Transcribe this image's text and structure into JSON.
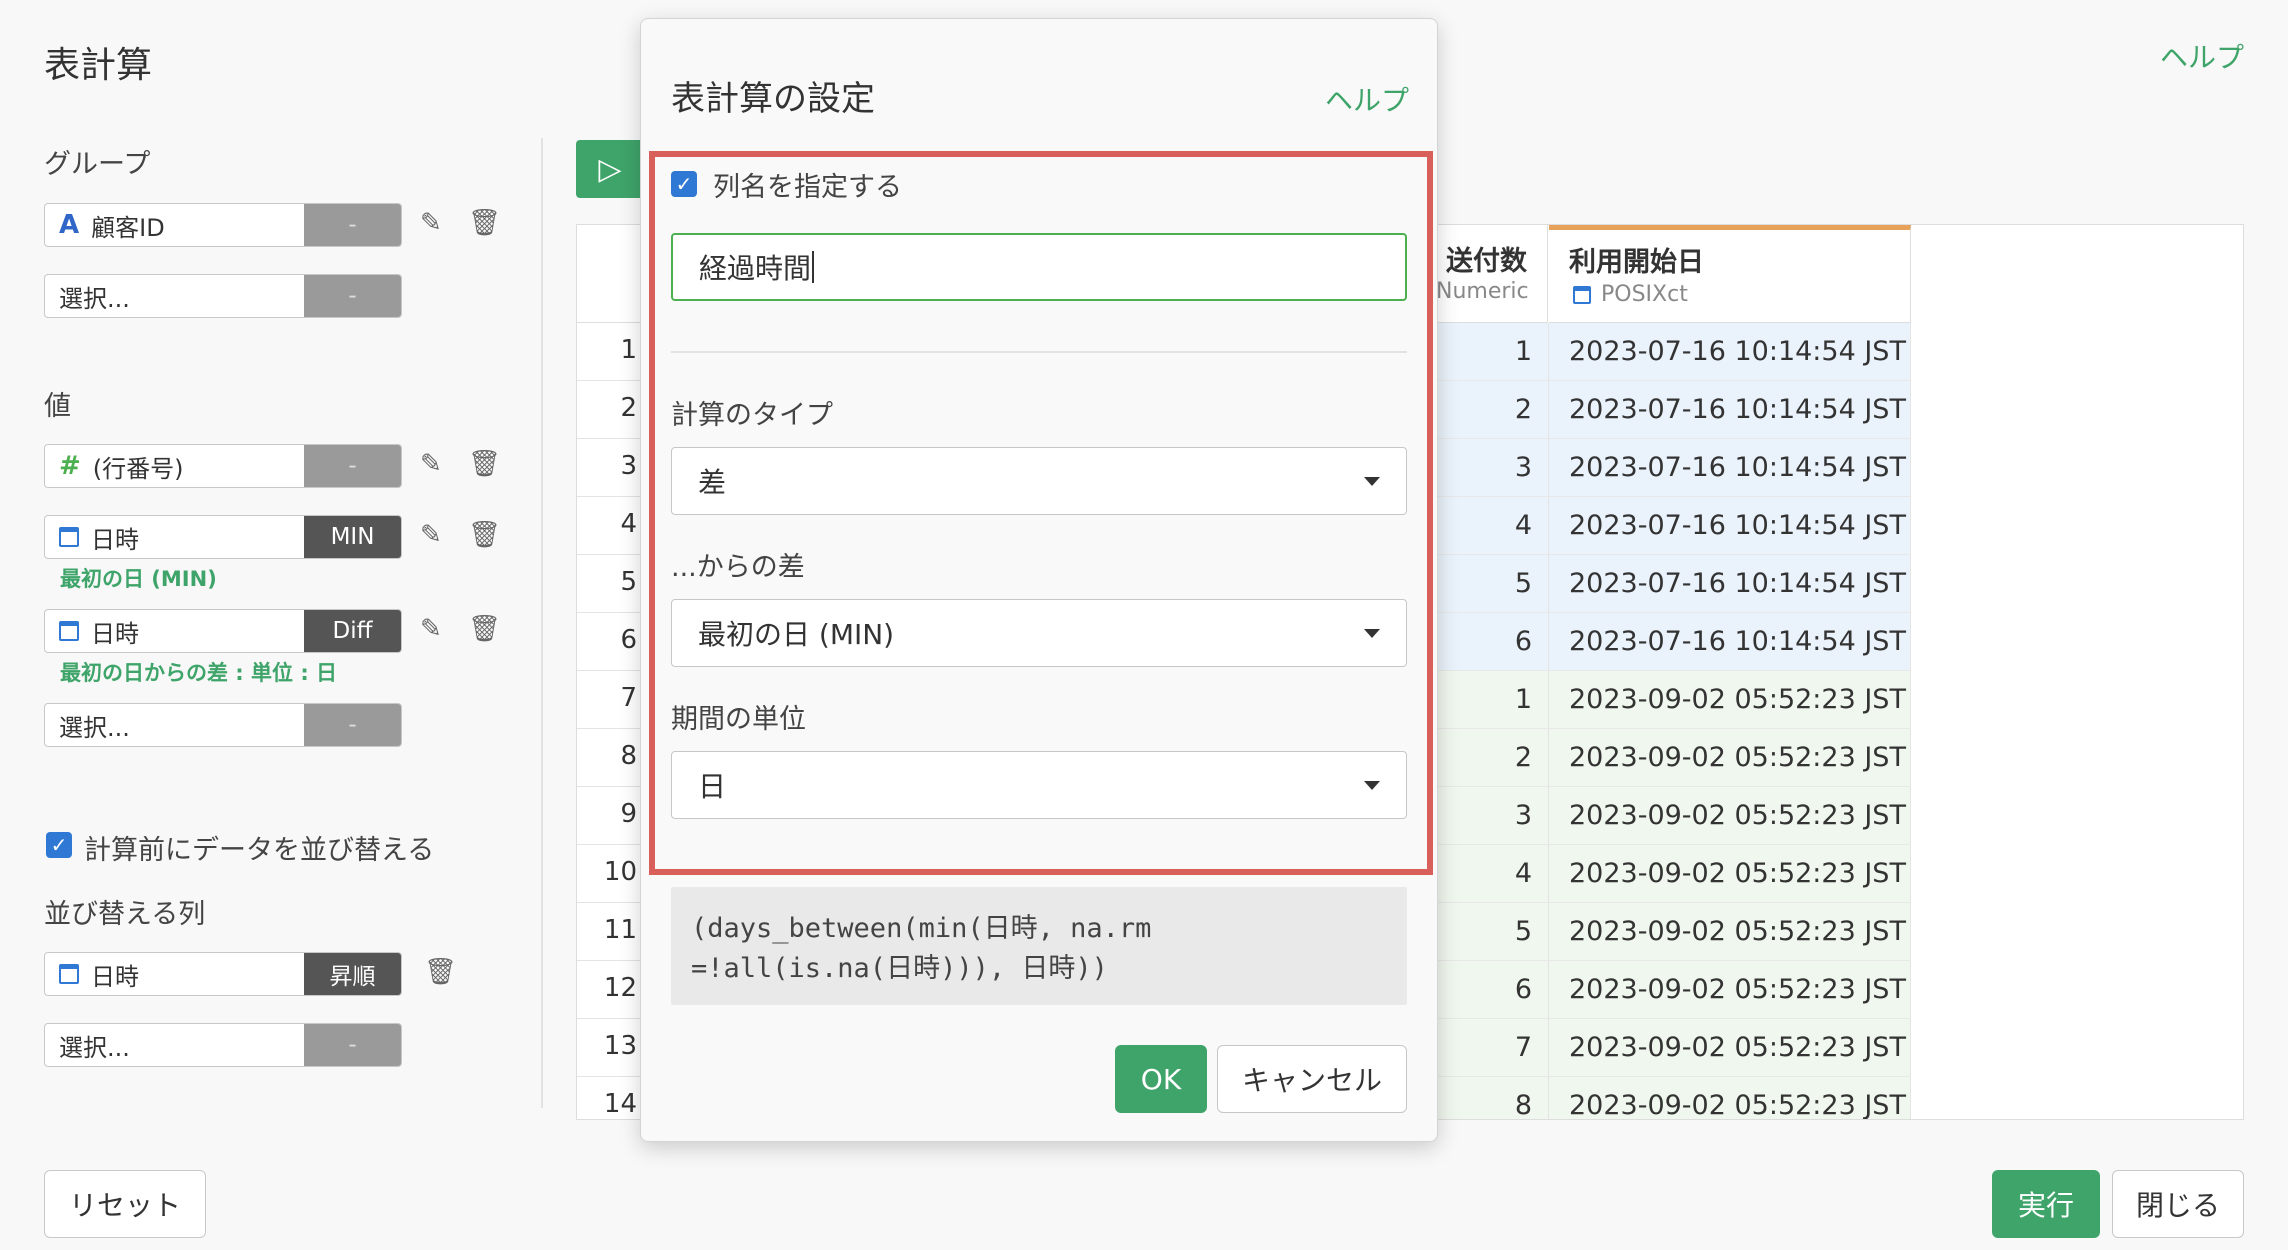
{
  "page": {
    "title": "表計算",
    "help": "ヘルプ"
  },
  "left": {
    "group_label": "グループ",
    "group_items": [
      {
        "icon": "string-type-icon",
        "text": "顧客ID",
        "agg": "-"
      },
      {
        "text": "選択...",
        "agg": "-"
      }
    ],
    "value_label": "値",
    "value_items": [
      {
        "icon": "numeric-type-icon",
        "text": "(行番号)",
        "agg": "-"
      },
      {
        "icon": "calendar-icon",
        "text": "日時",
        "agg": "MIN",
        "note": "最初の日 (MIN)"
      },
      {
        "icon": "calendar-icon",
        "text": "日時",
        "agg": "Diff",
        "note": "最初の日からの差 : 単位 : 日"
      },
      {
        "text": "選択...",
        "agg": "-"
      }
    ],
    "sort_checkbox": {
      "label": "計算前にデータを並び替える",
      "checked": true
    },
    "sort_label": "並び替える列",
    "sort_items": [
      {
        "icon": "calendar-icon",
        "text": "日時",
        "agg": "昇順"
      },
      {
        "text": "選択...",
        "agg": "-"
      }
    ]
  },
  "table": {
    "row_numbers": [
      "1",
      "2",
      "3",
      "4",
      "5",
      "6",
      "7",
      "8",
      "9",
      "10",
      "11",
      "12",
      "13",
      "14"
    ],
    "columns": [
      {
        "name": "送付数",
        "type": "Numeric",
        "values": [
          "1",
          "2",
          "3",
          "4",
          "5",
          "6",
          "1",
          "2",
          "3",
          "4",
          "5",
          "6",
          "7",
          "8"
        ]
      },
      {
        "name": "利用開始日",
        "type": "POSIXct",
        "values": [
          "2023-07-16 10:14:54 JST",
          "2023-07-16 10:14:54 JST",
          "2023-07-16 10:14:54 JST",
          "2023-07-16 10:14:54 JST",
          "2023-07-16 10:14:54 JST",
          "2023-07-16 10:14:54 JST",
          "2023-09-02 05:52:23 JST",
          "2023-09-02 05:52:23 JST",
          "2023-09-02 05:52:23 JST",
          "2023-09-02 05:52:23 JST",
          "2023-09-02 05:52:23 JST",
          "2023-09-02 05:52:23 JST",
          "2023-09-02 05:52:23 JST",
          "2023-09-02 05:52:23 JST"
        ]
      }
    ]
  },
  "modal": {
    "title": "表計算の設定",
    "help": "ヘルプ",
    "column_name_checkbox": {
      "label": "列名を指定する",
      "checked": true
    },
    "column_name_value": "経過時間",
    "calc_type_label": "計算のタイプ",
    "calc_type_value": "差",
    "diff_from_label": "...からの差",
    "diff_from_value": "最初の日 (MIN)",
    "unit_label": "期間の単位",
    "unit_value": "日",
    "expression_line1": "(days_between(min(日時, na.rm",
    "expression_line2": "=!all(is.na(日時))), 日時))",
    "ok": "OK",
    "cancel": "キャンセル"
  },
  "footer": {
    "reset": "リセット",
    "run": "実行",
    "close": "閉じる"
  },
  "colors": {
    "accent_green": "#3fa46a",
    "highlight_red": "#d9605a",
    "row_blue": "#eaf2fb",
    "row_green": "#f0f7ee"
  }
}
